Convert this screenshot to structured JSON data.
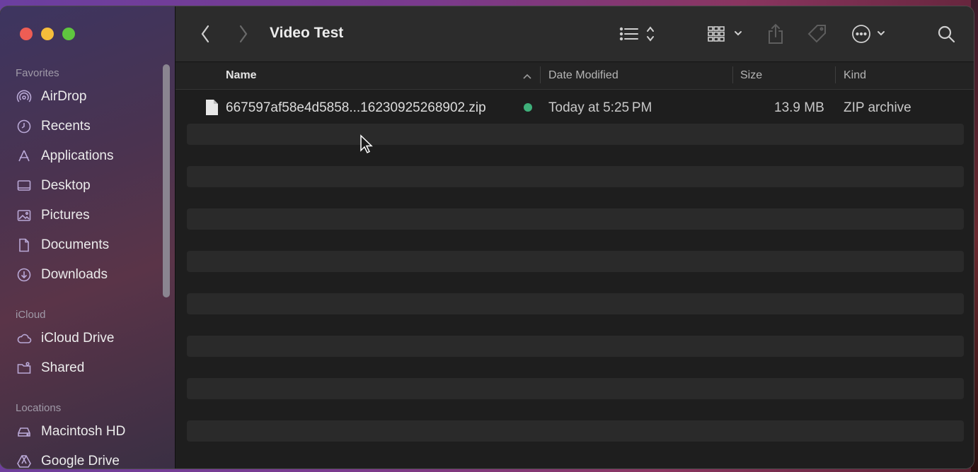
{
  "window": {
    "title": "Video Test"
  },
  "toolbar": {
    "back_icon": "chevron-left-icon",
    "forward_icon": "chevron-right-icon",
    "view_icon": "list-view-icon",
    "group_icon": "grid-group-icon",
    "share_icon": "share-icon",
    "tag_icon": "tag-icon",
    "more_icon": "ellipsis-circle-icon",
    "search_icon": "search-icon"
  },
  "sidebar": {
    "favorites_label": "Favorites",
    "favorites": [
      {
        "label": "AirDrop",
        "icon": "airdrop-icon"
      },
      {
        "label": "Recents",
        "icon": "clock-icon"
      },
      {
        "label": "Applications",
        "icon": "applications-icon"
      },
      {
        "label": "Desktop",
        "icon": "desktop-icon"
      },
      {
        "label": "Pictures",
        "icon": "pictures-icon"
      },
      {
        "label": "Documents",
        "icon": "document-icon"
      },
      {
        "label": "Downloads",
        "icon": "download-icon"
      }
    ],
    "icloud_label": "iCloud",
    "icloud": [
      {
        "label": "iCloud Drive",
        "icon": "cloud-icon"
      },
      {
        "label": "Shared",
        "icon": "shared-folder-icon"
      }
    ],
    "locations_label": "Locations",
    "locations": [
      {
        "label": "Macintosh HD",
        "icon": "disk-icon"
      },
      {
        "label": "Google Drive",
        "icon": "google-drive-icon"
      }
    ]
  },
  "columns": {
    "name": "Name",
    "date": "Date Modified",
    "size": "Size",
    "kind": "Kind",
    "sort": "ascending"
  },
  "files": [
    {
      "name": "667597af58e4d5858...16230925268902.zip",
      "date": "Today at 5:25 PM",
      "size": "13.9 MB",
      "kind": "ZIP archive",
      "sync_status_color": "#3fb07a"
    }
  ],
  "colors": {
    "traffic_red": "#ee5d54",
    "traffic_yellow": "#f6bd3b",
    "traffic_green": "#5fc53f"
  }
}
